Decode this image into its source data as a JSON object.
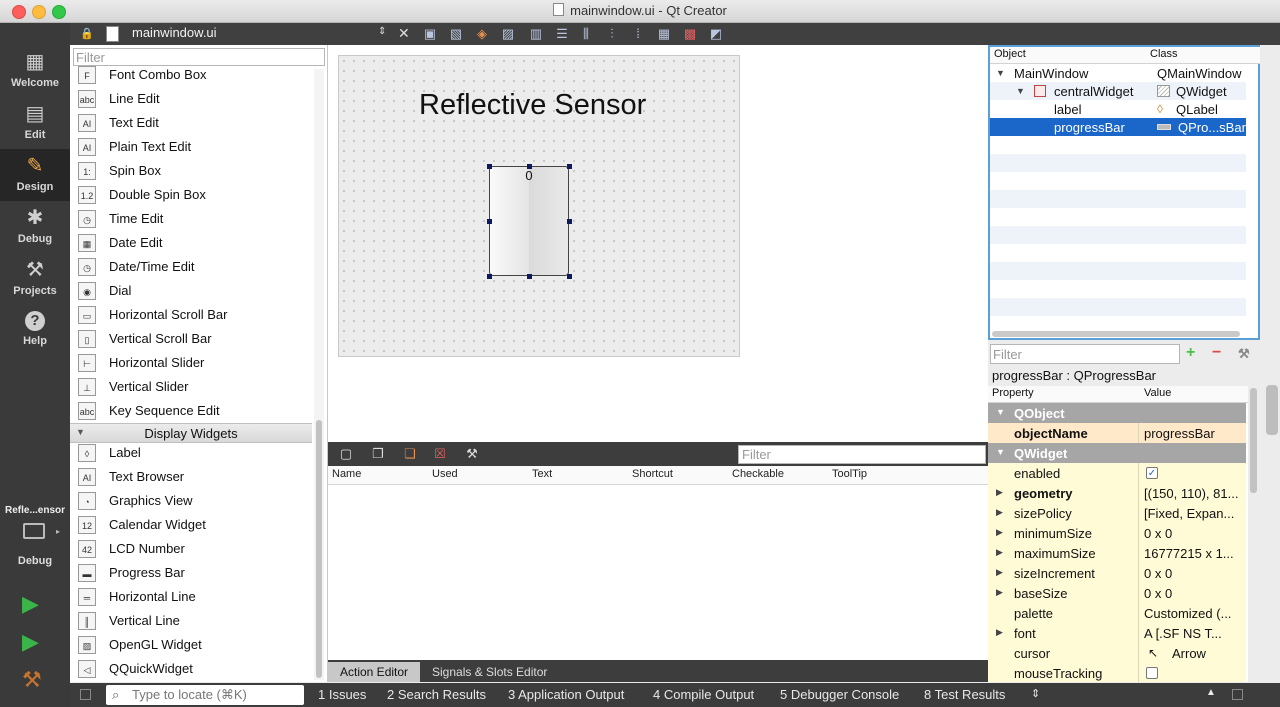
{
  "window": {
    "title": "mainwindow.ui - Qt Creator"
  },
  "modes": [
    {
      "label": "Welcome",
      "icon": "grid-icon"
    },
    {
      "label": "Edit",
      "icon": "edit-icon"
    },
    {
      "label": "Design",
      "icon": "design-icon"
    },
    {
      "label": "Debug",
      "icon": "bug-icon"
    },
    {
      "label": "Projects",
      "icon": "wrench-icon"
    },
    {
      "label": "Help",
      "icon": "help-icon"
    }
  ],
  "editor_toolbar": {
    "filename": "mainwindow.ui"
  },
  "widget_box": {
    "filter_placeholder": "Filter",
    "items": [
      "Font Combo Box",
      "Line Edit",
      "Text Edit",
      "Plain Text Edit",
      "Spin Box",
      "Double Spin Box",
      "Time Edit",
      "Date Edit",
      "Date/Time Edit",
      "Dial",
      "Horizontal Scroll Bar",
      "Vertical Scroll Bar",
      "Horizontal Slider",
      "Vertical Slider",
      "Key Sequence Edit"
    ],
    "category": "Display Widgets",
    "display_items": [
      "Label",
      "Text Browser",
      "Graphics View",
      "Calendar Widget",
      "LCD Number",
      "Progress Bar",
      "Horizontal Line",
      "Vertical Line",
      "OpenGL Widget",
      "QQuickWidget"
    ]
  },
  "form": {
    "title": "Reflective Sensor",
    "progress_value": "0"
  },
  "action_editor": {
    "filter_placeholder": "Filter",
    "columns": [
      "Name",
      "Used",
      "Text",
      "Shortcut",
      "Checkable",
      "ToolTip"
    ],
    "tabs": [
      "Action Editor",
      "Signals & Slots Editor"
    ]
  },
  "object_inspector": {
    "columns": [
      "Object",
      "Class"
    ],
    "rows": [
      {
        "name": "MainWindow",
        "class": "QMainWindow"
      },
      {
        "name": "centralWidget",
        "class": "QWidget"
      },
      {
        "name": "label",
        "class": "QLabel"
      },
      {
        "name": "progressBar",
        "class": "QPro...sBar"
      }
    ]
  },
  "property_editor": {
    "filter_placeholder": "Filter",
    "subtitle": "progressBar : QProgressBar",
    "columns": [
      "Property",
      "Value"
    ],
    "rows": [
      {
        "name": "QObject",
        "value": ""
      },
      {
        "name": "objectName",
        "value": "progressBar"
      },
      {
        "name": "QWidget",
        "value": ""
      },
      {
        "name": "enabled",
        "value": ""
      },
      {
        "name": "geometry",
        "value": "[(150, 110), 81..."
      },
      {
        "name": "sizePolicy",
        "value": "[Fixed, Expan..."
      },
      {
        "name": "minimumSize",
        "value": "0 x 0"
      },
      {
        "name": "maximumSize",
        "value": "16777215 x 1..."
      },
      {
        "name": "sizeIncrement",
        "value": "0 x 0"
      },
      {
        "name": "baseSize",
        "value": "0 x 0"
      },
      {
        "name": "palette",
        "value": "Customized (..."
      },
      {
        "name": "font",
        "value": "A  [.SF NS T..."
      },
      {
        "name": "cursor",
        "value": "Arrow"
      },
      {
        "name": "mouseTracking",
        "value": ""
      }
    ]
  },
  "project_selector": {
    "name": "Refle...ensor",
    "config": "Debug"
  },
  "status_bar": {
    "locate_placeholder": "Type to locate (⌘K)",
    "panes": [
      "1  Issues",
      "2  Search Results",
      "3  Application Output",
      "4  Compile Output",
      "5  Debugger Console",
      "8  Test Results"
    ]
  },
  "colors": {
    "accent": "#1a66c9",
    "mode_active": "#f0a64a",
    "sidebar": "#3a3a3a"
  }
}
